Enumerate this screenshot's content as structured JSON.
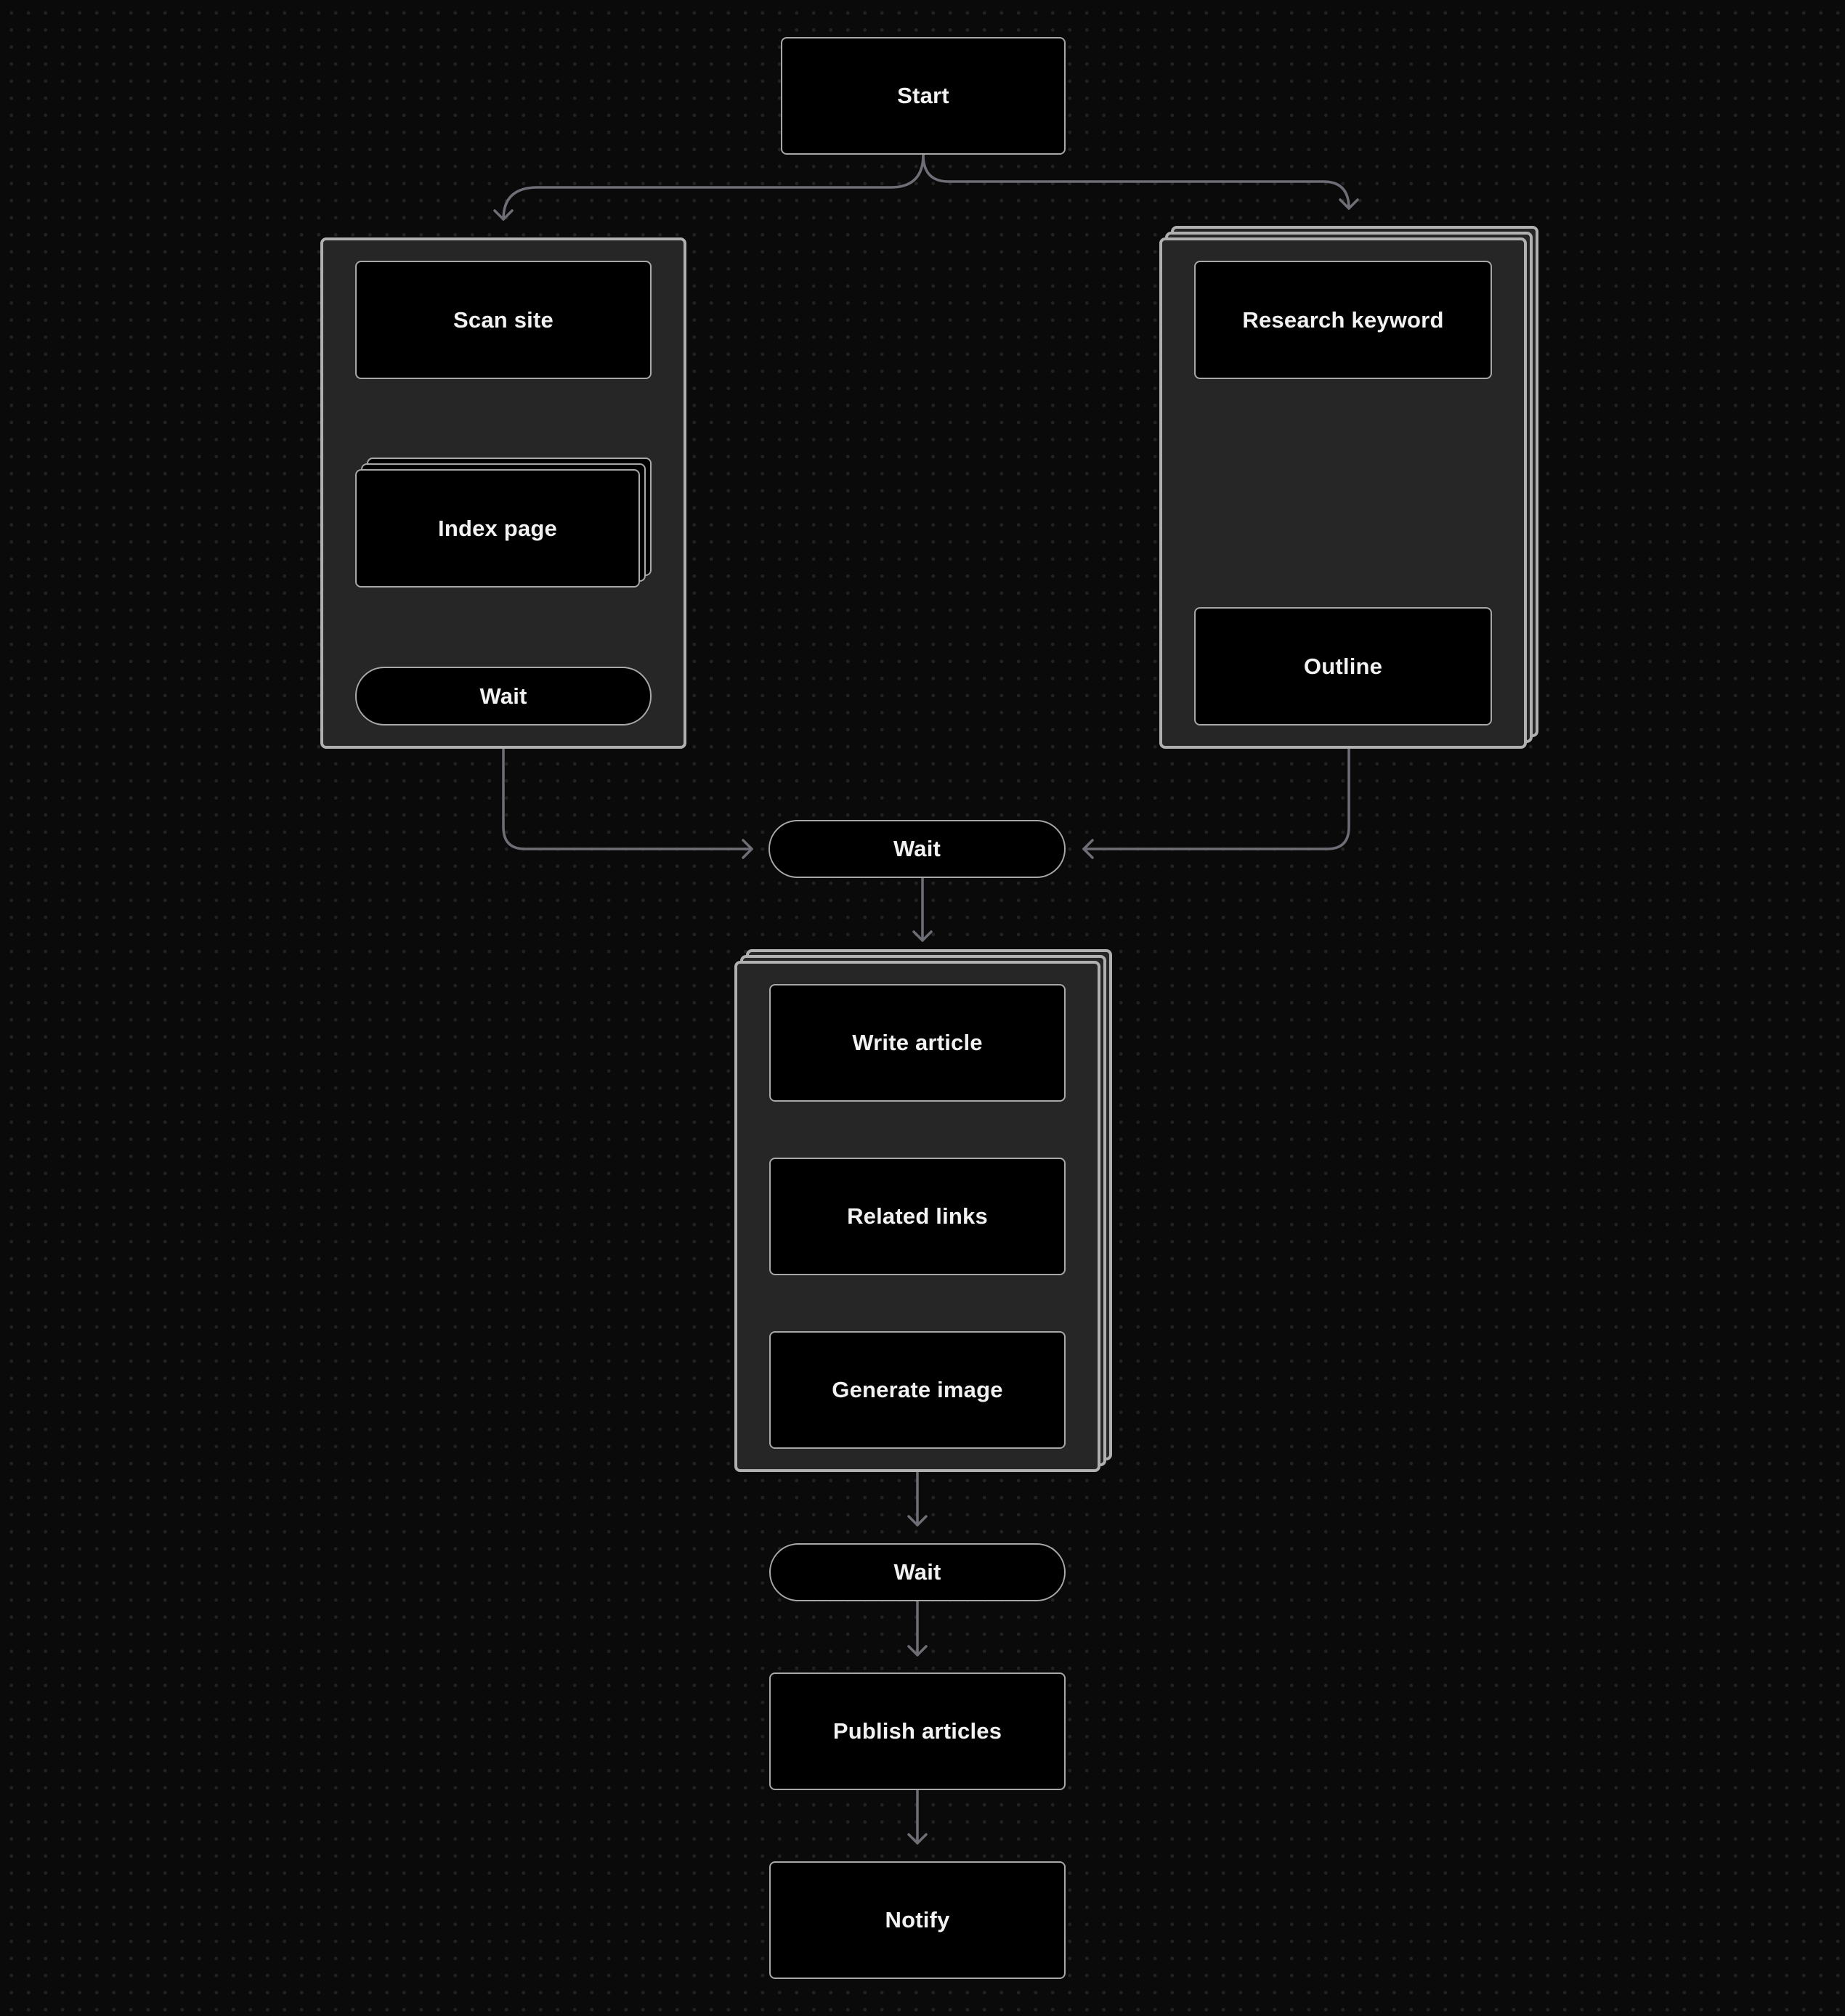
{
  "diagram": {
    "type": "workflow-flowchart",
    "colors": {
      "background": "#0a0a0a",
      "grid_dot": "#222222",
      "group_fill": "#262626",
      "border": "#b0b0b0",
      "node_fill": "#000000",
      "connector": "#6e6e76",
      "text": "#f2f2f2"
    },
    "nodes": {
      "start": "Start",
      "scan_site": "Scan site",
      "index_page": "Index page",
      "wait_left": "Wait",
      "research_keyword": "Research keyword",
      "outline": "Outline",
      "wait_merge": "Wait",
      "write_article": "Write article",
      "related_links": "Related links",
      "generate_image": "Generate image",
      "wait_final": "Wait",
      "publish_articles": "Publish articles",
      "notify": "Notify"
    },
    "groups": [
      {
        "id": "site-group",
        "stacked": false,
        "contains": [
          "scan_site",
          "index_page",
          "wait_left"
        ]
      },
      {
        "id": "keyword-group",
        "stacked": true,
        "contains": [
          "research_keyword",
          "outline"
        ]
      },
      {
        "id": "article-group",
        "stacked": true,
        "contains": [
          "write_article",
          "related_links",
          "generate_image"
        ]
      }
    ],
    "stacked_nodes": [
      "index_page"
    ],
    "pill_nodes": [
      "wait_left",
      "wait_merge",
      "wait_final"
    ],
    "edges": [
      [
        "start",
        "site-group"
      ],
      [
        "start",
        "keyword-group"
      ],
      [
        "scan_site",
        "index_page"
      ],
      [
        "index_page",
        "wait_left"
      ],
      [
        "research_keyword",
        "outline"
      ],
      [
        "site-group",
        "wait_merge"
      ],
      [
        "keyword-group",
        "wait_merge"
      ],
      [
        "wait_merge",
        "article-group"
      ],
      [
        "write_article",
        "related_links"
      ],
      [
        "related_links",
        "generate_image"
      ],
      [
        "article-group",
        "wait_final"
      ],
      [
        "wait_final",
        "publish_articles"
      ],
      [
        "publish_articles",
        "notify"
      ]
    ]
  }
}
